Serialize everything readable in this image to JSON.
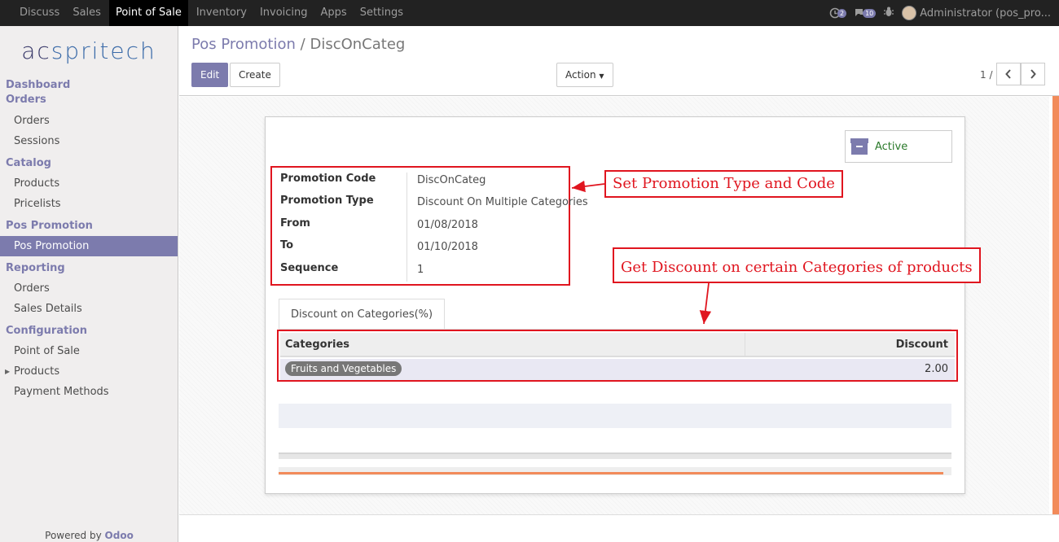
{
  "navbar": {
    "items": [
      "Discuss",
      "Sales",
      "Point of Sale",
      "Inventory",
      "Invoicing",
      "Apps",
      "Settings"
    ],
    "active": "Point of Sale",
    "activity_count": "2",
    "message_count": "10",
    "user": "Administrator (pos_pro..."
  },
  "sidebar": {
    "logo_a": "ac",
    "logo_b": "spritech",
    "sections": [
      {
        "title": "Dashboard",
        "items": []
      },
      {
        "title": "Orders",
        "items": [
          "Orders",
          "Sessions"
        ]
      },
      {
        "title": "Catalog",
        "items": [
          "Products",
          "Pricelists"
        ]
      },
      {
        "title": "Pos Promotion",
        "items": [
          "Pos Promotion"
        ]
      },
      {
        "title": "Reporting",
        "items": [
          "Orders",
          "Sales Details"
        ]
      },
      {
        "title": "Configuration",
        "items": [
          "Point of Sale",
          "Products",
          "Payment Methods"
        ]
      }
    ],
    "powered_by": "Powered by",
    "brand": "Odoo"
  },
  "breadcrumb": {
    "parent": "Pos Promotion",
    "separator": "/",
    "current": "DiscOnCateg"
  },
  "buttons": {
    "edit": "Edit",
    "create": "Create",
    "action": "Action"
  },
  "pager": {
    "value": "1 / 1"
  },
  "record": {
    "active_label": "Active",
    "fields": [
      {
        "label": "Promotion Code",
        "value": "DiscOnCateg"
      },
      {
        "label": "Promotion Type",
        "value": "Discount On Multiple Categories"
      },
      {
        "label": "From",
        "value": "01/08/2018"
      },
      {
        "label": "To",
        "value": "01/10/2018"
      },
      {
        "label": "Sequence",
        "value": "1"
      }
    ],
    "tab": "Discount on Categories(%)",
    "table": {
      "headers": [
        "Categories",
        "Discount"
      ],
      "rows": [
        {
          "category": "Fruits and Vegetables",
          "discount": "2.00"
        }
      ]
    }
  },
  "annotations": {
    "type_code": "Set Promotion Type and Code",
    "categories": "Get Discount on certain Categories of products"
  },
  "colors": {
    "accent": "#7c7bad",
    "annotation": "#e0151f",
    "active_text": "#2b7a2b"
  }
}
